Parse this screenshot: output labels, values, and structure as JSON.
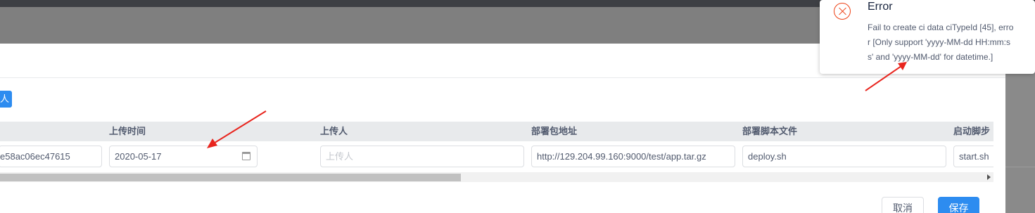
{
  "notice": {
    "title": "Error",
    "desc_line1": "Fail to create ci data ciTypeId [45], erro",
    "desc_line2": "r [Only support 'yyyy-MM-dd HH:mm:s",
    "desc_line3": "s' and 'yyyy-MM-dd' for datetime.]"
  },
  "tag": {
    "label": "人"
  },
  "table": {
    "headers": [
      "上传时间",
      "上传人",
      "部署包地址",
      "部署脚本文件",
      "启动脚步"
    ],
    "row": {
      "guid_value": "e58ac06ec47615",
      "upload_time": "2020-05-17",
      "uploader_placeholder": "上传人",
      "package_url": "http://129.204.99.160:9000/test/app.tar.gz",
      "deploy_script": "deploy.sh",
      "start_script": "start.sh"
    }
  },
  "buttons": {
    "cancel": "取消",
    "save": "保存"
  },
  "colors": {
    "primary": "#2d8cf0",
    "error": "#ed4014",
    "annotation": "#e8251e"
  }
}
